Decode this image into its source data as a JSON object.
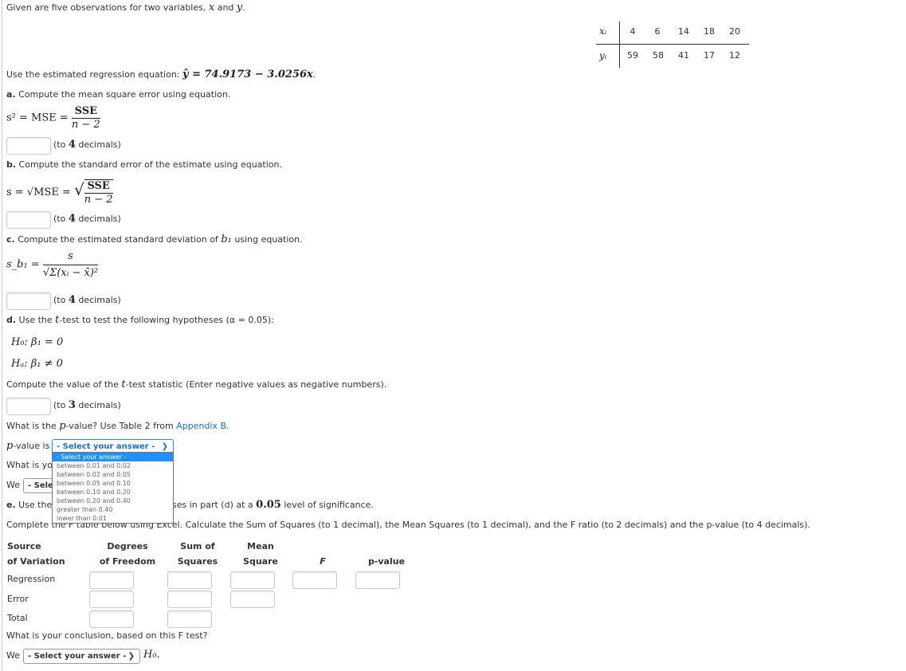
{
  "intro": "Given are five observations for two variables, x and y.",
  "intro_parts": {
    "pre": "Given are five observations for two variables, ",
    "x": "x",
    "and": " and ",
    "y": "y",
    "end": "."
  },
  "obs_table": {
    "x_label": "xᵢ",
    "y_label": "yᵢ",
    "x": [
      "4",
      "6",
      "14",
      "18",
      "20"
    ],
    "y": [
      "59",
      "58",
      "41",
      "17",
      "12"
    ]
  },
  "regression": {
    "pre": "Use the estimated regression equation: ",
    "eq": "ŷ = 74.9173 − 3.0256x",
    "end": "."
  },
  "part_a": {
    "letter": "a.",
    "text": " Compute the mean square error using equation.",
    "lhs": "s² = MSE = ",
    "num": "SSE",
    "den": "n − 2",
    "hint_pre": "(to ",
    "hint_n": "4",
    "hint_post": " decimals)"
  },
  "part_b": {
    "letter": "b.",
    "text": " Compute the standard error of the estimate using equation.",
    "lhs": "s = √MSE = ",
    "num": "SSE",
    "den": "n − 2",
    "hint_pre": "(to ",
    "hint_n": "4",
    "hint_post": " decimals)"
  },
  "part_c": {
    "letter": "c.",
    "text_pre": " Compute the estimated standard deviation of ",
    "b1": "b₁",
    "text_post": " using equation.",
    "lhs": "s_b₁ = ",
    "num": "s",
    "den": "√Σ(xᵢ − x̄)²",
    "hint_pre": "(to ",
    "hint_n": "4",
    "hint_post": " decimals)"
  },
  "part_d": {
    "letter": "d.",
    "text_pre": " Use the ",
    "t": "t",
    "text_post": "-test to test the following hypotheses (α = 0.05):",
    "h0": "H₀: β₁ = 0",
    "ha": "Hₐ: β₁ ≠ 0",
    "compute_pre": "Compute the value of the ",
    "compute_post": "-test statistic (Enter negative values as negative numbers).",
    "hint_pre": "(to ",
    "hint_n": "3",
    "hint_post": " decimals)",
    "pvalue_q_pre": "What is the ",
    "p": "p",
    "pvalue_q_mid": "-value? Use Table 2 from ",
    "appendix_link": "Appendix B.",
    "pvalue_label": "-value is",
    "pvalue_selected": "- Select your answer -",
    "pvalue_options": [
      "- Select your answer -",
      "between 0.01 and 0.02",
      "between 0.02 and 0.05",
      "between 0.05 and 0.10",
      "between 0.10 and 0.20",
      "between 0.20 and 0.40",
      "greater than 0.40",
      "lower than 0.01"
    ],
    "conclusion_q_visible": "What is yo",
    "we": "We",
    "we_select_visible": "- Sele"
  },
  "part_e": {
    "letter": "e.",
    "visible_pre": " Use the",
    "visible_post": "ses in part (d) at a ",
    "alpha": "0.05",
    "post2": " level of significance.",
    "complete": "Complete the F table below using Excel. Calculate the Sum of Squares (to 1 decimal), the Mean Squares (to 1 decimal), and the F ratio (to 2 decimals) and the p-value (to 4 decimals)."
  },
  "anova": {
    "headers": [
      [
        "Source",
        "of Variation"
      ],
      [
        "Degrees",
        "of Freedom"
      ],
      [
        "Sum of",
        "Squares"
      ],
      [
        "Mean",
        "Square"
      ],
      [
        "",
        "F"
      ],
      [
        "",
        "p-value"
      ]
    ],
    "rows": [
      "Regression",
      "Error",
      "Total"
    ]
  },
  "conclusion": {
    "question": "What is your conclusion, based on this F test?",
    "we": "We",
    "select": "- Select your answer -",
    "h0": "H₀."
  },
  "colors": {
    "accent": "#1e90ff",
    "link": "#1a6fc9"
  }
}
